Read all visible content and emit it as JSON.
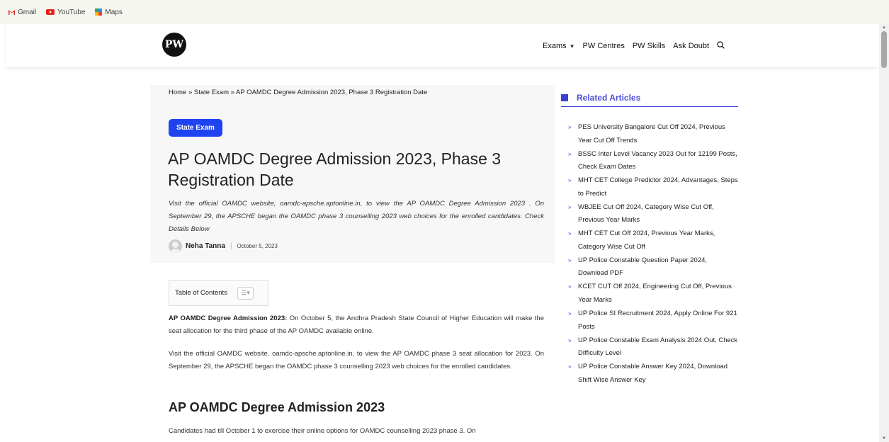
{
  "bookmarks": [
    {
      "label": "Gmail",
      "icon": "gmail-icon"
    },
    {
      "label": "YouTube",
      "icon": "youtube-icon"
    },
    {
      "label": "Maps",
      "icon": "maps-icon"
    }
  ],
  "header": {
    "logo_text": "PW",
    "nav": {
      "exams": "Exams",
      "centres": "PW Centres",
      "skills": "PW Skills",
      "ask": "Ask Doubt"
    }
  },
  "article": {
    "breadcrumb": "Home » State Exam » AP OAMDC Degree Admission 2023, Phase 3 Registration Date",
    "category": "State Exam",
    "title": "AP OAMDC Degree Admission 2023, Phase 3 Registration Date",
    "excerpt": "Visit the official OAMDC website, oamdc-apsche.aptonline.in, to view the AP OAMDC Degree Admission 2023 . On September 29, the APSCHE began the OAMDC phase 3 counselling 2023 web choices for the enrolled candidates. Check Details Below",
    "author": "Neha Tanna",
    "date": "October 5, 2023",
    "toc_label": "Table of Contents",
    "para1_bold": "AP OAMDC Degree Admission 2023:",
    "para1": " On October 5, the Andhra Pradesh State Council of Higher Education will make the seat allocation for the third phase of the AP OAMDC available online.",
    "para2": "Visit the official OAMDC website, oamdc-apsche.aptonline.in, to view the AP OAMDC phase 3 seat allocation for 2023. On September 29, the APSCHE began the OAMDC phase 3 counselling 2023 web choices for the enrolled candidates.",
    "h2": "AP OAMDC Degree Admission 2023",
    "para3": "Candidates had till October 1 to exercise their online options for OAMDC counselling 2023 phase 3. On"
  },
  "sidebar": {
    "heading": "Related Articles",
    "items": [
      "PES University Bangalore Cut Off 2024, Previous Year Cut Off Trends",
      "BSSC Inter Level Vacancy 2023 Out for 12199 Posts, Check Exam Dates",
      "MHT CET College Predictor 2024, Advantages, Steps to Predict",
      "WBJEE Cut Off 2024, Category Wise Cut Off, Previous Year Marks",
      "MHT CET Cut Off 2024, Previous Year Marks, Category Wise Cut Off",
      "UP Police Constable Question Paper 2024, Download PDF",
      "KCET CUT Off 2024, Engineering Cut Off, Previous Year Marks",
      "UP Police SI Recruitment 2024, Apply Online For 921 Posts",
      "UP Police Constable Exam Analysis 2024 Out, Check Difficulty Level",
      "UP Police Constable Answer Key 2024, Download Shift Wise Answer Key"
    ]
  }
}
